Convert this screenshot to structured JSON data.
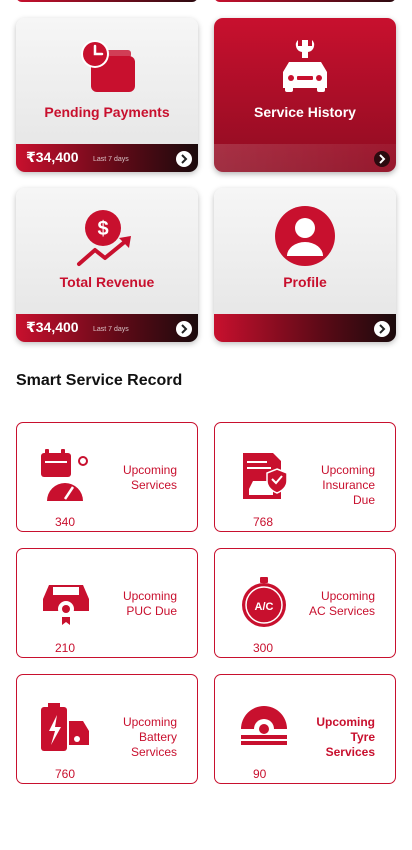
{
  "colors": {
    "accent": "#c8102e",
    "dark": "#8f0c22"
  },
  "tiles": [
    {
      "title": "Pending Payments",
      "amount": "₹34,400",
      "period": "Last 7 days",
      "icon": "wallet-clock-icon"
    },
    {
      "title": "Service History",
      "icon": "car-wrench-icon"
    },
    {
      "title": "Total Revenue",
      "amount": "₹34,400",
      "period": "Last 7 days",
      "icon": "dollar-growth-icon"
    },
    {
      "title": "Profile",
      "icon": "user-avatar-icon"
    }
  ],
  "section": {
    "title": "Smart Service Record"
  },
  "cards": [
    {
      "label": "Upcoming\nServices",
      "count": "340",
      "icon": "calendar-gauge-icon"
    },
    {
      "label": "Upcoming\nInsurance\nDue",
      "count": "768",
      "icon": "insurance-doc-icon"
    },
    {
      "label": "Upcoming\nPUC Due",
      "count": "210",
      "icon": "car-puc-icon"
    },
    {
      "label": "Upcoming\nAC Services",
      "count": "300",
      "icon": "ac-timer-icon"
    },
    {
      "label": "Upcoming\nBattery\nServices",
      "count": "760",
      "icon": "battery-car-icon"
    },
    {
      "label": "Upcoming\nTyre\nServices",
      "count": "90",
      "icon": "tyre-icon"
    }
  ]
}
